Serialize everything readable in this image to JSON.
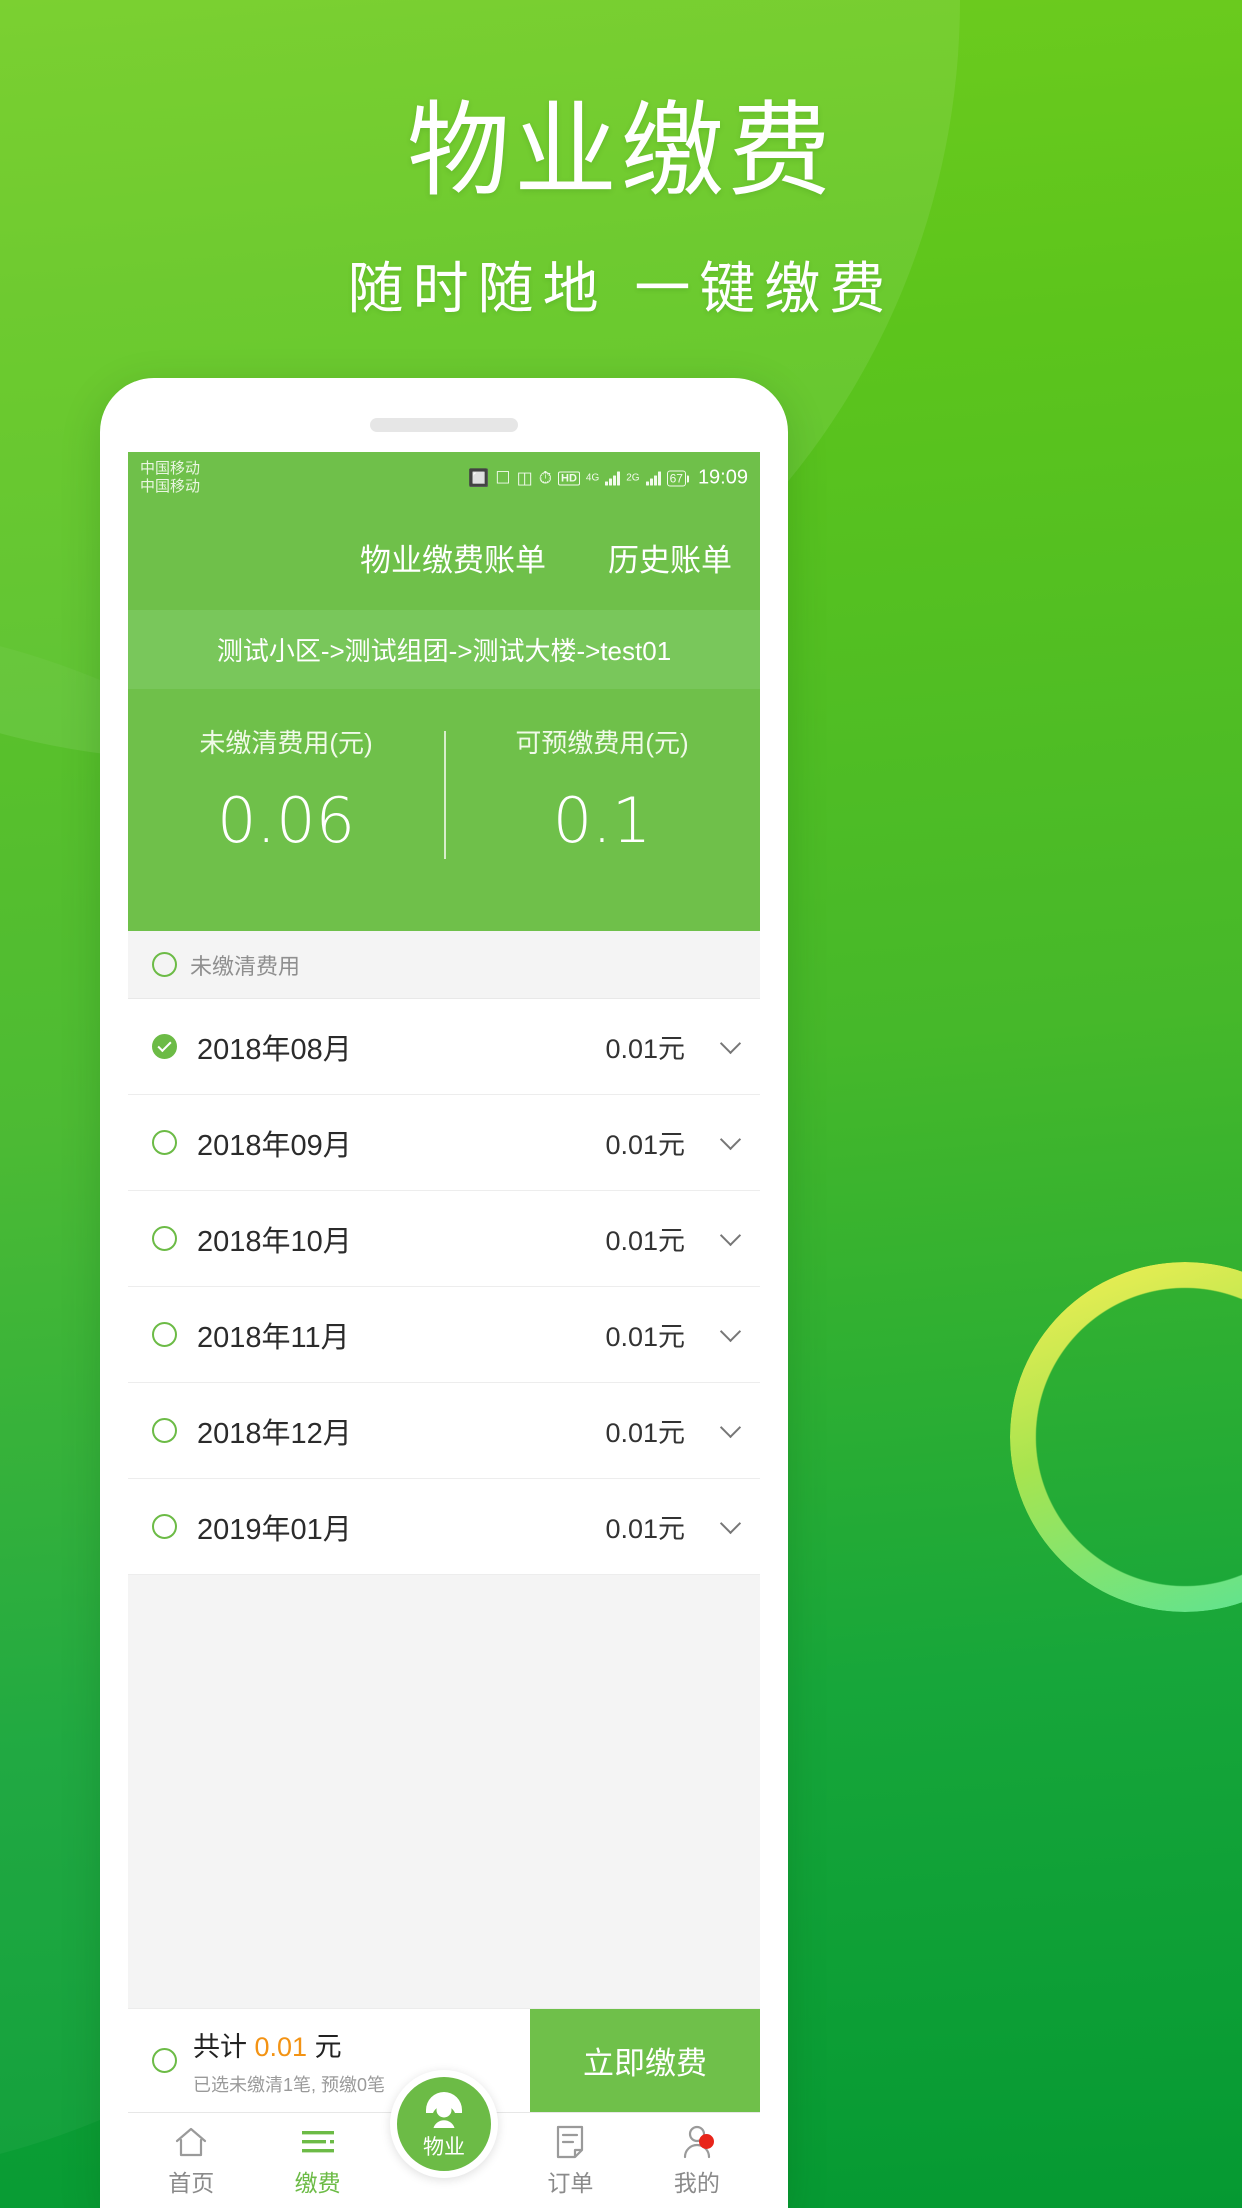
{
  "hero": {
    "title": "物业缴费",
    "subtitle": "随时随地 一键缴费"
  },
  "colors": {
    "brand_green": "#6fc04a",
    "deep_green": "#059932",
    "light_green": "#6fcc1e",
    "accent_orange": "#f39314",
    "badge_red": "#e8251a"
  },
  "phone": {
    "statusbar": {
      "carrier_line1": "中国移动",
      "carrier_line2": "中国移动",
      "icons": [
        "bluetooth-icon",
        "nfc-icon",
        "vibrate-icon",
        "alarm-icon",
        "hd-icon",
        "signal-4g-icon",
        "signal-2g-icon",
        "battery-icon"
      ],
      "hd_label": "HD",
      "net1_label": "4G",
      "net2_label": "2G",
      "battery_level": "67",
      "clock": "19:09"
    },
    "appbar": {
      "title": "物业缴费账单",
      "history_tab": "历史账单"
    },
    "breadcrumb": "测试小区->测试组团->测试大楼->test01",
    "summary": {
      "unpaid_label": "未缴清费用(元)",
      "unpaid_value": "0.06",
      "prepay_label": "可预缴费用(元)",
      "prepay_value": "0.1"
    },
    "section_header": {
      "label": "未缴清费用",
      "checked": false
    },
    "bills": [
      {
        "month": "2018年08月",
        "amount": "0.01元",
        "checked": true
      },
      {
        "month": "2018年09月",
        "amount": "0.01元",
        "checked": false
      },
      {
        "month": "2018年10月",
        "amount": "0.01元",
        "checked": false
      },
      {
        "month": "2018年11月",
        "amount": "0.01元",
        "checked": false
      },
      {
        "month": "2018年12月",
        "amount": "0.01元",
        "checked": false
      },
      {
        "month": "2019年01月",
        "amount": "0.01元",
        "checked": false
      }
    ],
    "paybar": {
      "total_prefix": "共计",
      "total_amount": "0.01",
      "total_suffix": "元",
      "selection_note": "已选未缴清1笔, 预缴0笔",
      "pay_button": "立即缴费"
    },
    "tabbar": {
      "items": [
        {
          "label": "首页",
          "icon": "home-icon",
          "active": false
        },
        {
          "label": "缴费",
          "icon": "list-icon",
          "active": true
        },
        {
          "label": "订单",
          "icon": "order-doc-icon",
          "active": false
        },
        {
          "label": "我的",
          "icon": "person-icon",
          "active": false,
          "badge": true
        }
      ],
      "fab": {
        "label": "物业",
        "icon": "headset-operator-icon"
      }
    }
  }
}
